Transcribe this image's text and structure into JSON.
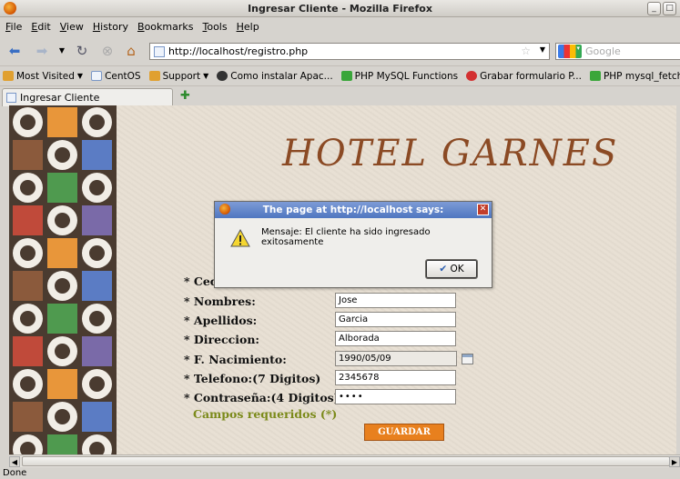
{
  "window": {
    "title": "Ingresar Cliente - Mozilla Firefox"
  },
  "menu": [
    "File",
    "Edit",
    "View",
    "History",
    "Bookmarks",
    "Tools",
    "Help"
  ],
  "nav": {
    "url": "http://localhost/registro.php",
    "search_placeholder": "Google"
  },
  "bookmarks": [
    {
      "label": "Most Visited",
      "icon": "folder-icon",
      "color": "#e0a030"
    },
    {
      "label": "CentOS",
      "icon": "page-icon",
      "color": "#7a97c7"
    },
    {
      "label": "Support",
      "icon": "folder-icon",
      "color": "#e0a030"
    },
    {
      "label": "Como instalar Apac...",
      "icon": "globe-icon",
      "color": "#333333"
    },
    {
      "label": "PHP MySQL Functions",
      "icon": "green-page-icon",
      "color": "#3aa63a"
    },
    {
      "label": "Grabar formulario P...",
      "icon": "red-mark-icon",
      "color": "#d33030"
    },
    {
      "label": "PHP mysql_fetch_ar...",
      "icon": "green-page-icon",
      "color": "#3aa63a"
    }
  ],
  "tab": {
    "label": "Ingresar Cliente"
  },
  "page": {
    "title": "HOTEL GARNES",
    "fields": [
      {
        "label": "* Ced",
        "value": ""
      },
      {
        "label": "* Nombres:",
        "value": "Jose"
      },
      {
        "label": "* Apellidos:",
        "value": "Garcia"
      },
      {
        "label": "* Direccion:",
        "value": "Alborada"
      },
      {
        "label": "* F. Nacimiento:",
        "value": "1990/05/09"
      },
      {
        "label": "* Telefono:(7 Digitos)",
        "value": "2345678"
      },
      {
        "label": "* Contraseña:(4 Digitos)",
        "value": "••••"
      }
    ],
    "required_note": "Campos requeridos (*)",
    "save_label": "GUARDAR"
  },
  "dialog": {
    "title": "The page at http://localhost says:",
    "message": "Mensaje: El cliente ha sido ingresado exitosamente",
    "ok_label": "OK"
  },
  "status": {
    "text": "Done"
  },
  "tile_colors": [
    "#e8963a",
    "#8b5a3c",
    "#5b7cc4",
    "#4f9a4f",
    "#c04a3a",
    "#7a6aa8"
  ]
}
